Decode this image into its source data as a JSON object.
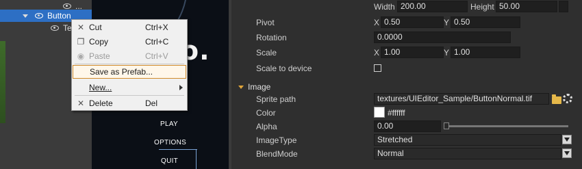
{
  "hierarchy": {
    "items": [
      {
        "label": "...",
        "selected": false
      },
      {
        "label": "Button",
        "selected": true
      },
      {
        "label": "Te",
        "selected": false
      }
    ]
  },
  "viewport": {
    "logo_text": "o.",
    "menu": [
      "PLAY",
      "OPTIONS",
      "QUIT"
    ]
  },
  "context_menu": {
    "items": [
      {
        "label": "Cut",
        "shortcut": "Ctrl+X",
        "icon": "cut-icon",
        "enabled": true
      },
      {
        "label": "Copy",
        "shortcut": "Ctrl+C",
        "icon": "copy-icon",
        "enabled": true
      },
      {
        "label": "Paste",
        "shortcut": "Ctrl+V",
        "icon": "paste-icon",
        "enabled": false
      },
      {
        "label": "Save as Prefab...",
        "shortcut": "",
        "icon": "",
        "enabled": true,
        "highlighted": true
      },
      {
        "label": "New...",
        "shortcut": "",
        "icon": "",
        "enabled": true,
        "submenu": true
      },
      {
        "label": "Delete",
        "shortcut": "Del",
        "icon": "delete-icon",
        "enabled": true
      }
    ]
  },
  "inspector": {
    "size": {
      "width_label": "Width",
      "width": "200.00",
      "height_label": "Height",
      "height": "50.00"
    },
    "pivot": {
      "label": "Pivot",
      "x_label": "X",
      "x": "0.50",
      "y_label": "Y",
      "y": "0.50"
    },
    "rotation": {
      "label": "Rotation",
      "value": "0.0000"
    },
    "scale": {
      "label": "Scale",
      "x_label": "X",
      "x": "1.00",
      "y_label": "Y",
      "y": "1.00"
    },
    "scale_to_device": {
      "label": "Scale to device",
      "checked": false
    },
    "image_section": {
      "title": "Image",
      "sprite_path_label": "Sprite path",
      "sprite_path": "textures/UIEditor_Sample/ButtonNormal.tif",
      "color_label": "Color",
      "color_value": "#ffffff",
      "alpha_label": "Alpha",
      "alpha_value": "0.00",
      "alpha_level": 0.0,
      "image_type_label": "ImageType",
      "image_type": "Stretched",
      "blend_mode_label": "BlendMode",
      "blend_mode": "Normal"
    }
  },
  "colors": {
    "selection": "#2d6fc4",
    "section_arrow": "#e0a53a",
    "highlight_border": "#d08a2a"
  }
}
